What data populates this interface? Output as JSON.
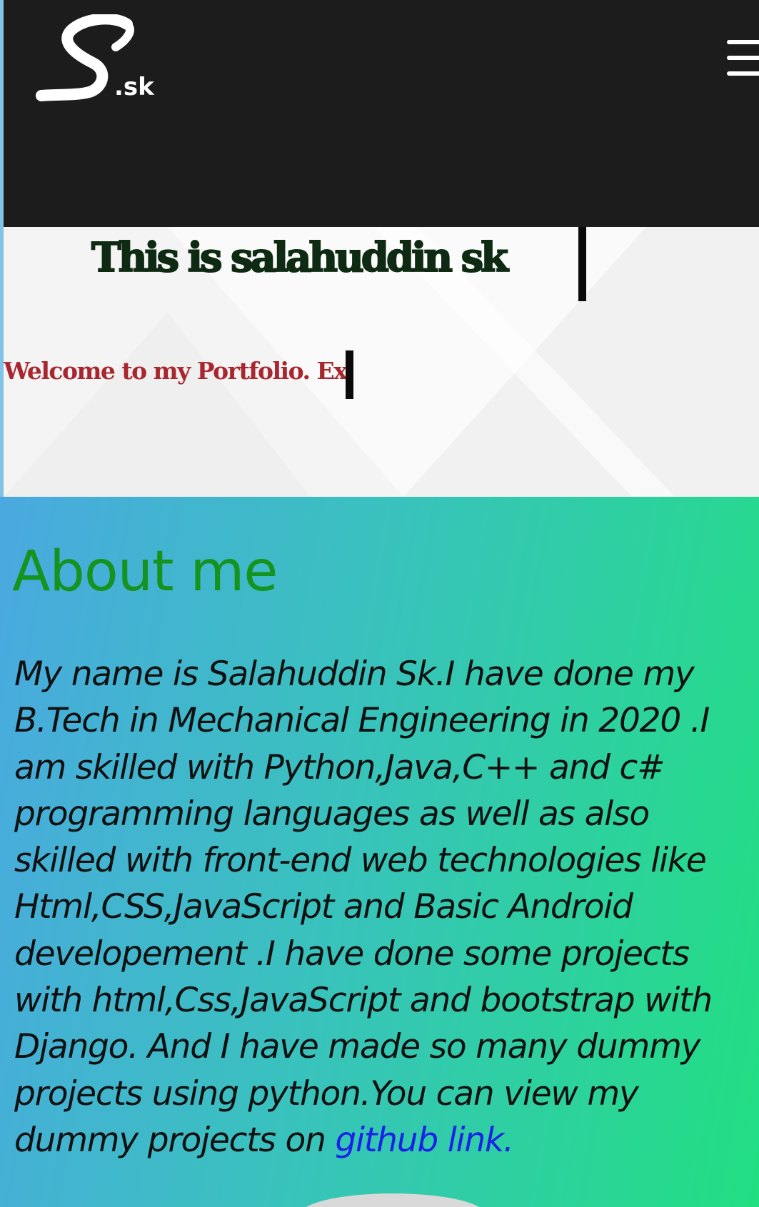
{
  "header": {
    "logo_letter": "S",
    "logo_suffix": ".sk",
    "menu_icon": "hamburger-menu-icon"
  },
  "hero": {
    "title": "This is salahuddin sk",
    "subtitle": "Welcome to my Portfolio. Ex"
  },
  "about": {
    "heading": "About me",
    "paragraph": "My name is Salahuddin Sk.I have done my\nB.Tech in Mechanical Engineering in 2020 .I\nam skilled with Python,Java,C++ and c#\nprogramming languages as well as also\nskilled with front-end web technologies like\nHtml,CSS,JavaScript and Basic Android\ndevelopement .I have done some projects\nwith html,Css,JavaScript and bootstrap with\nDjango. And I have made so many dummy\nprojects using python.You can view my\ndummy projects on ",
    "link_label": "github link."
  },
  "colors": {
    "header_bg": "#1c1c1c",
    "hero_title": "#0e2a12",
    "hero_subtitle": "#a8262e",
    "about_heading": "#16931f",
    "link": "#1a22e6",
    "gradient_start": "#4aa9e0",
    "gradient_end": "#22df82"
  }
}
